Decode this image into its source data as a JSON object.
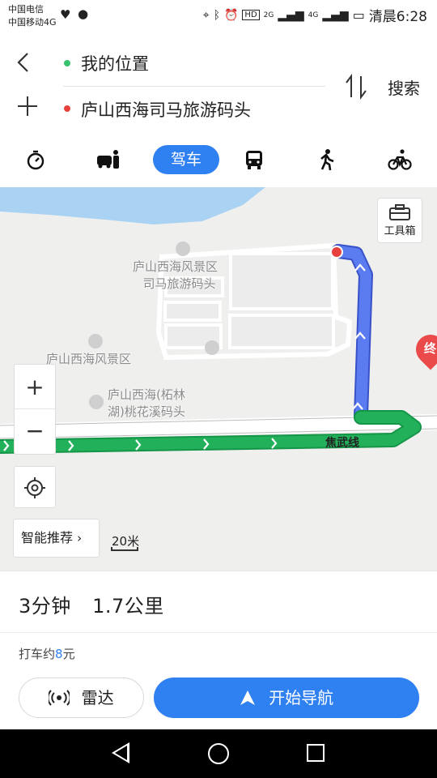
{
  "status_bar": {
    "carrier_1": "中国电信",
    "carrier_2": "中国移动4G",
    "signal_1": "2G",
    "signal_2": "4G",
    "time": "清晨6:28"
  },
  "route": {
    "from": "我的位置",
    "to": "庐山西海司马旅游码头",
    "search_label": "搜索"
  },
  "modes": {
    "active_label": "驾车",
    "items": [
      "timer-icon",
      "car-person-icon",
      "car",
      "bus-icon",
      "walk-icon",
      "bike-icon"
    ]
  },
  "map": {
    "toolbox_label": "工具箱",
    "zoom_in": "+",
    "zoom_out": "−",
    "recommend_label": "智能推荐",
    "scale": "20米",
    "labels": {
      "pier_line1": "庐山西海风景区",
      "pier_line2": "司马旅游码头",
      "scenic_area": "庐山西海风景区",
      "peach_line1": "庐山西海(柘林",
      "peach_line2": "湖)桃花溪码头",
      "road": "焦武线"
    },
    "end_marker": "终",
    "colors": {
      "route_blue": "#5b7cf0",
      "route_green": "#22b15a",
      "accent": "#2f80f0"
    }
  },
  "summary": {
    "duration": "3分钟",
    "distance": "1.7公里",
    "taxi_prefix": "打车约",
    "taxi_price": "8",
    "taxi_suffix": "元"
  },
  "actions": {
    "radar_label": "雷达",
    "navigate_label": "开始导航"
  }
}
